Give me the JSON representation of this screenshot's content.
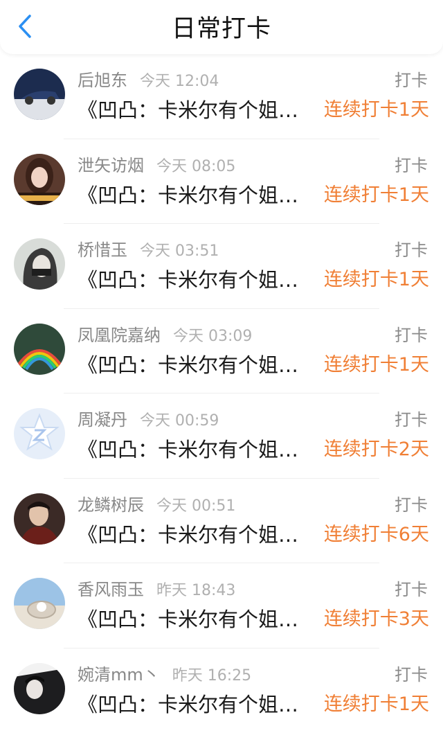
{
  "header": {
    "title": "日常打卡",
    "back_icon": "chevron-left-icon",
    "accent_color": "#2b8ff2"
  },
  "streak_color": "#f07f35",
  "items": [
    {
      "name": "后旭东",
      "time": "今天 12:04",
      "action": "打卡",
      "message": "《凹凸：卡米尔有个姐…",
      "streak": "连续打卡1天"
    },
    {
      "name": "泄矢访烟",
      "time": "今天 08:05",
      "action": "打卡",
      "message": "《凹凸：卡米尔有个姐…",
      "streak": "连续打卡1天"
    },
    {
      "name": "桥惜玉",
      "time": "今天 03:51",
      "action": "打卡",
      "message": "《凹凸：卡米尔有个姐…",
      "streak": "连续打卡1天"
    },
    {
      "name": "凤凰院嘉纳",
      "time": "今天 03:09",
      "action": "打卡",
      "message": "《凹凸：卡米尔有个姐…",
      "streak": "连续打卡1天"
    },
    {
      "name": "周凝丹",
      "time": "今天 00:59",
      "action": "打卡",
      "message": "《凹凸：卡米尔有个姐…",
      "streak": "连续打卡2天"
    },
    {
      "name": "龙鳞树辰",
      "time": "今天 00:51",
      "action": "打卡",
      "message": "《凹凸：卡米尔有个姐…",
      "streak": "连续打卡6天"
    },
    {
      "name": "香风雨玉",
      "time": "昨天 18:43",
      "action": "打卡",
      "message": "《凹凸：卡米尔有个姐…",
      "streak": "连续打卡3天"
    },
    {
      "name": "婉清mm丶",
      "time": "昨天 16:25",
      "action": "打卡",
      "message": "《凹凸：卡米尔有个姐…",
      "streak": "连续打卡1天"
    }
  ]
}
